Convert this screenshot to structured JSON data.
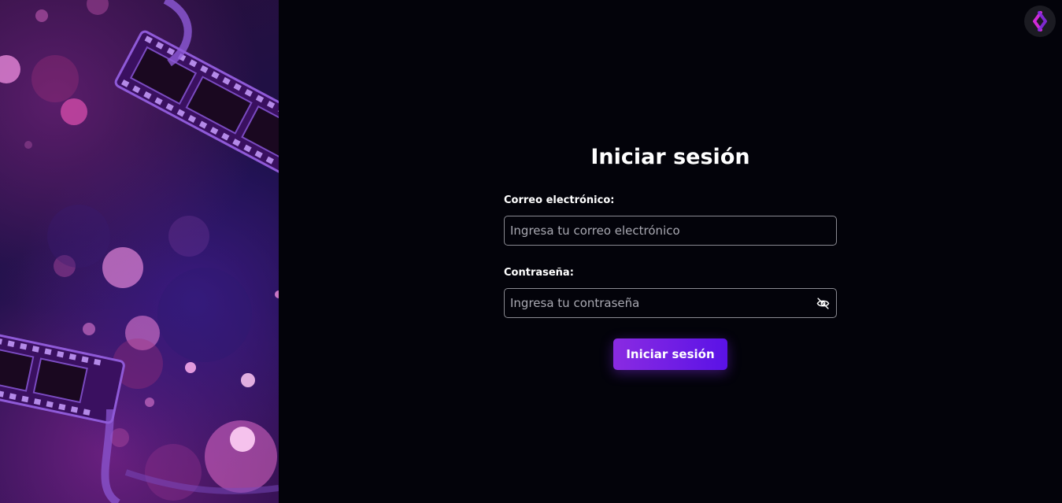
{
  "login": {
    "title": "Iniciar sesión",
    "email_label": "Correo electrónico:",
    "email_placeholder": "Ingresa tu correo electrónico",
    "email_value": "",
    "password_label": "Contraseña:",
    "password_placeholder": "Ingresa tu contraseña",
    "password_value": "",
    "password_toggle_icon": "eye-slash-icon",
    "submit_label": "Iniciar sesión"
  },
  "branding": {
    "logo_icon": "brand-logo-icon",
    "hero_image": "film-reel-bokeh-illustration"
  },
  "colors": {
    "background": "#03030a",
    "accent_start": "#8a2be2",
    "accent_end": "#5a12e6",
    "field_border": "#8a8a92",
    "text": "#ffffff",
    "placeholder": "#a9a9b2"
  }
}
